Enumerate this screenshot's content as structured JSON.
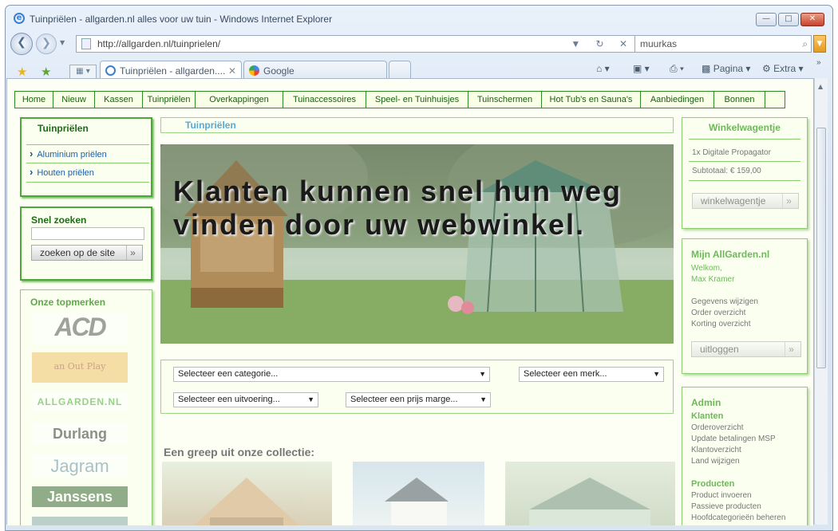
{
  "browser": {
    "window_title": "Tuinpriëlen - allgarden.nl alles voor uw tuin - Windows Internet Explorer",
    "url": "http://allgarden.nl/tuinprielen/",
    "search_value": "muurkas",
    "tabs": [
      {
        "label": "Tuinpriëlen - allgarden...."
      },
      {
        "label": "Google"
      }
    ],
    "commands": {
      "page": "Pagina",
      "extra": "Extra"
    }
  },
  "site": {
    "nav": [
      "Home",
      "Nieuw",
      "Kassen",
      "Tuinpriëlen",
      "Overkappingen",
      "Tuinaccessoires",
      "Speel- en Tuinhuisjes",
      "Tuinschermen",
      "Hot Tub's en Sauna's",
      "Aanbiedingen",
      "Bonnen"
    ],
    "left": {
      "category_title": "Tuinpriëlen",
      "category_links": [
        "Aluminium priëlen",
        "Houten priëlen"
      ],
      "quick_search_title": "Snel zoeken",
      "quick_search_button": "zoeken op de site",
      "brands_title": "Onze topmerken",
      "brands": [
        "ACD",
        "an Out Play",
        "ALLGARDEN.NL",
        "Durlang",
        "Jagram",
        "Janssens"
      ]
    },
    "breadcrumb": "Tuinpriëlen",
    "hero_caption": "Klanten kunnen snel hun weg vinden door uw webwinkel.",
    "filters": {
      "category": "Selecteer een categorie...",
      "brand": "Selecteer een merk...",
      "execution": "Selecteer een uitvoering...",
      "price": "Selecteer een prijs marge..."
    },
    "gallery_title": "Een greep uit onze collectie:",
    "cart": {
      "title": "Winkelwagentje",
      "item": "1x Digitale Propagator",
      "subtotal": "Subtotaal: € 159,00",
      "button": "winkelwagentje"
    },
    "account": {
      "title": "Mijn AllGarden.nl",
      "welcome": "Welkom,",
      "name": "Max Kramer",
      "links": [
        "Gegevens wijzigen",
        "Order overzicht",
        "Korting overzicht"
      ],
      "logout": "uitloggen"
    },
    "admin": {
      "title": "Admin",
      "sections": [
        {
          "title": "Klanten",
          "links": [
            "Orderoverzicht",
            "Update betalingen MSP",
            "Klantoverzicht",
            "Land wijzigen"
          ]
        },
        {
          "title": "Producten",
          "links": [
            "Product invoeren",
            "Passieve producten",
            "Hoofdcategorieën beheren"
          ]
        }
      ]
    }
  },
  "colors": {
    "accent_green": "#2f8a25",
    "link_blue": "#1f5fa5",
    "hero_text": "#1a1a1a"
  }
}
